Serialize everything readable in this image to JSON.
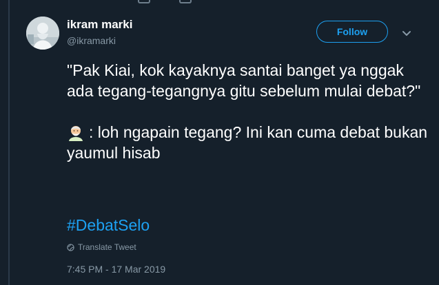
{
  "tweet": {
    "author_name": "ikram marki",
    "author_handle": "@ikramarki",
    "follow_label": "Follow",
    "paragraph_1": "\"Pak Kiai, kok kayaknya santai banget ya nggak ada tegang-tegangnya gitu sebelum mulai debat?\"",
    "paragraph_2": ": loh ngapain tegang? Ini kan cuma debat bukan yaumul hisab",
    "hashtag": "#DebatSelo",
    "translate_label": "Translate Tweet",
    "timestamp": "7:45 PM - 17 Mar 2019"
  },
  "icons": {
    "caret": "chevron-down-icon",
    "emoji": "old-man-emoji-icon",
    "globe": "globe-icon"
  },
  "colors": {
    "background": "#15202b",
    "text_primary": "#ffffff",
    "text_secondary": "#8899a6",
    "accent": "#1da1f2"
  }
}
